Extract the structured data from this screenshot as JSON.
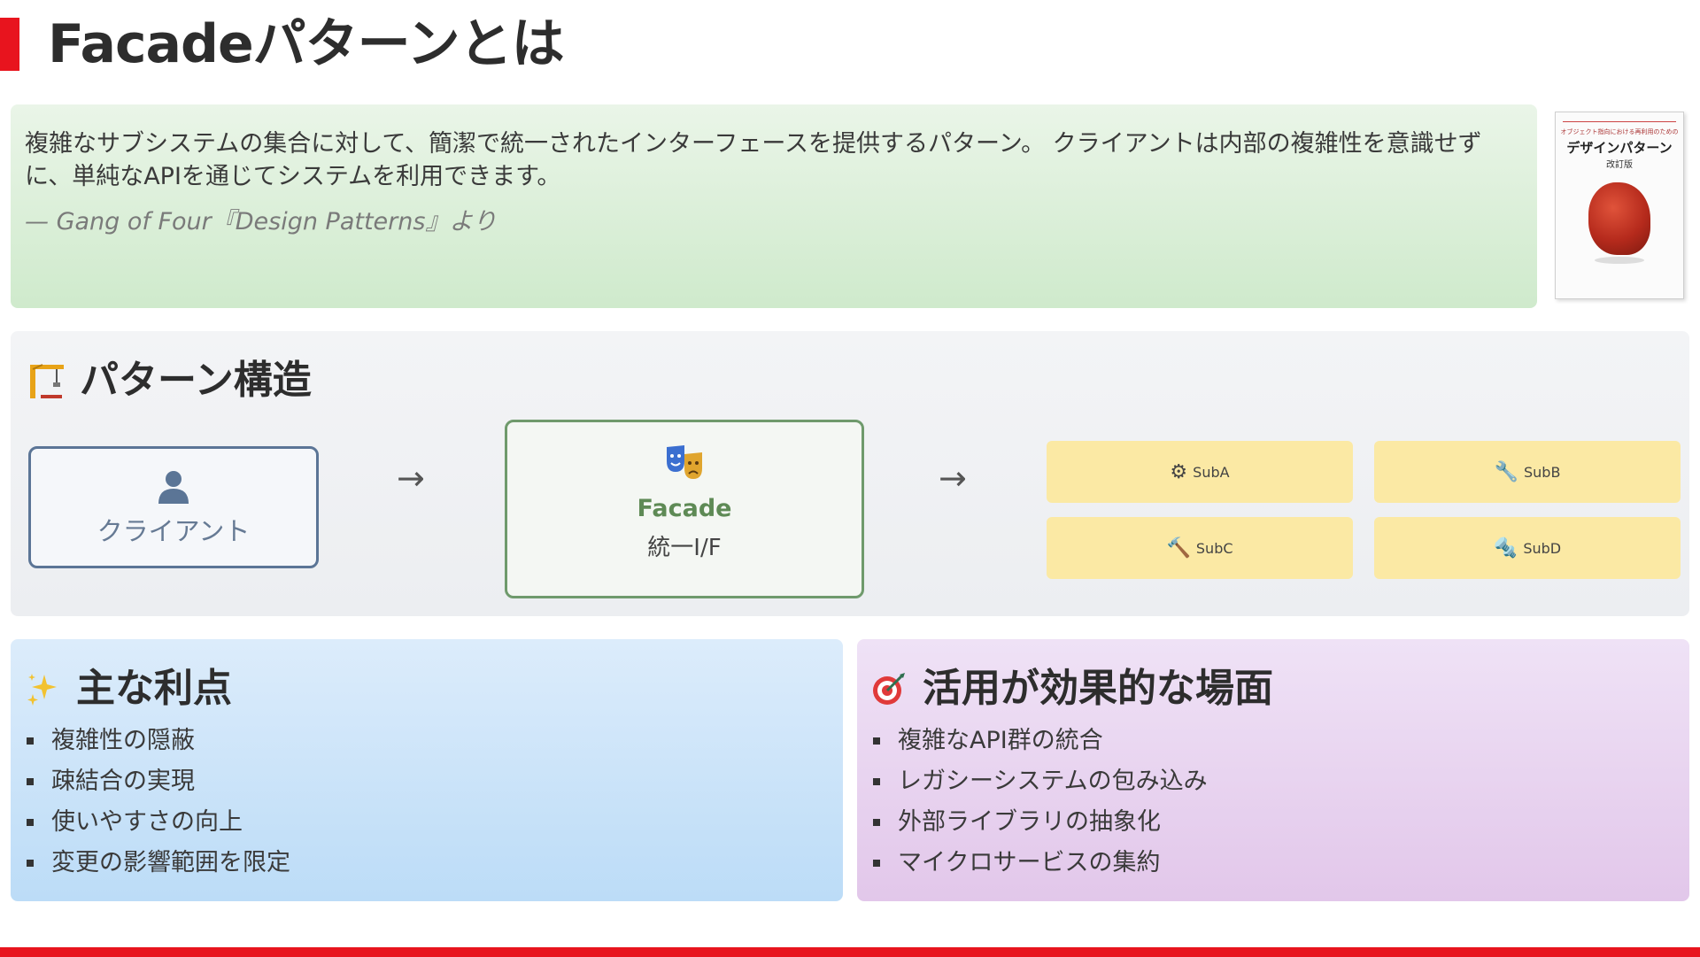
{
  "header": {
    "title": "Facadeパターンとは"
  },
  "definition": {
    "text": "複雑なサブシステムの集合に対して、簡潔で統一されたインターフェースを提供するパターン。 クライアントは内部の複雑性を意識せずに、単純なAPIを通じてシステムを利用できます。",
    "citation": "— Gang of Four『Design Patterns』より"
  },
  "book": {
    "subtitle": "オブジェクト指向における再利用のための",
    "title": "デザインパターン",
    "edition": "改訂版"
  },
  "structure": {
    "heading": "パターン構造",
    "client_label": "クライアント",
    "arrow1": "→",
    "facade_label": "Facade",
    "facade_sub": "統一I/F",
    "arrow2": "→",
    "subsystems": [
      {
        "label": "SubA",
        "icon": "⚙"
      },
      {
        "label": "SubB",
        "icon": "🔧"
      },
      {
        "label": "SubC",
        "icon": "🔨"
      },
      {
        "label": "SubD",
        "icon": "🔩"
      }
    ]
  },
  "benefits": {
    "heading": "主な利点",
    "items": [
      "複雑性の隠蔽",
      "疎結合の実現",
      "使いやすさの向上",
      "変更の影響範囲を限定"
    ]
  },
  "use_cases": {
    "heading": "活用が効果的な場面",
    "items": [
      "複雑なAPI群の統合",
      "レガシーシステムの包み込み",
      "外部ライブラリの抽象化",
      "マイクロサービスの集約"
    ]
  },
  "colors": {
    "accent": "#e8141e",
    "client_border": "#5b7596",
    "facade_border": "#6f9a6c",
    "subsystem_fill": "#fbe9a4"
  }
}
